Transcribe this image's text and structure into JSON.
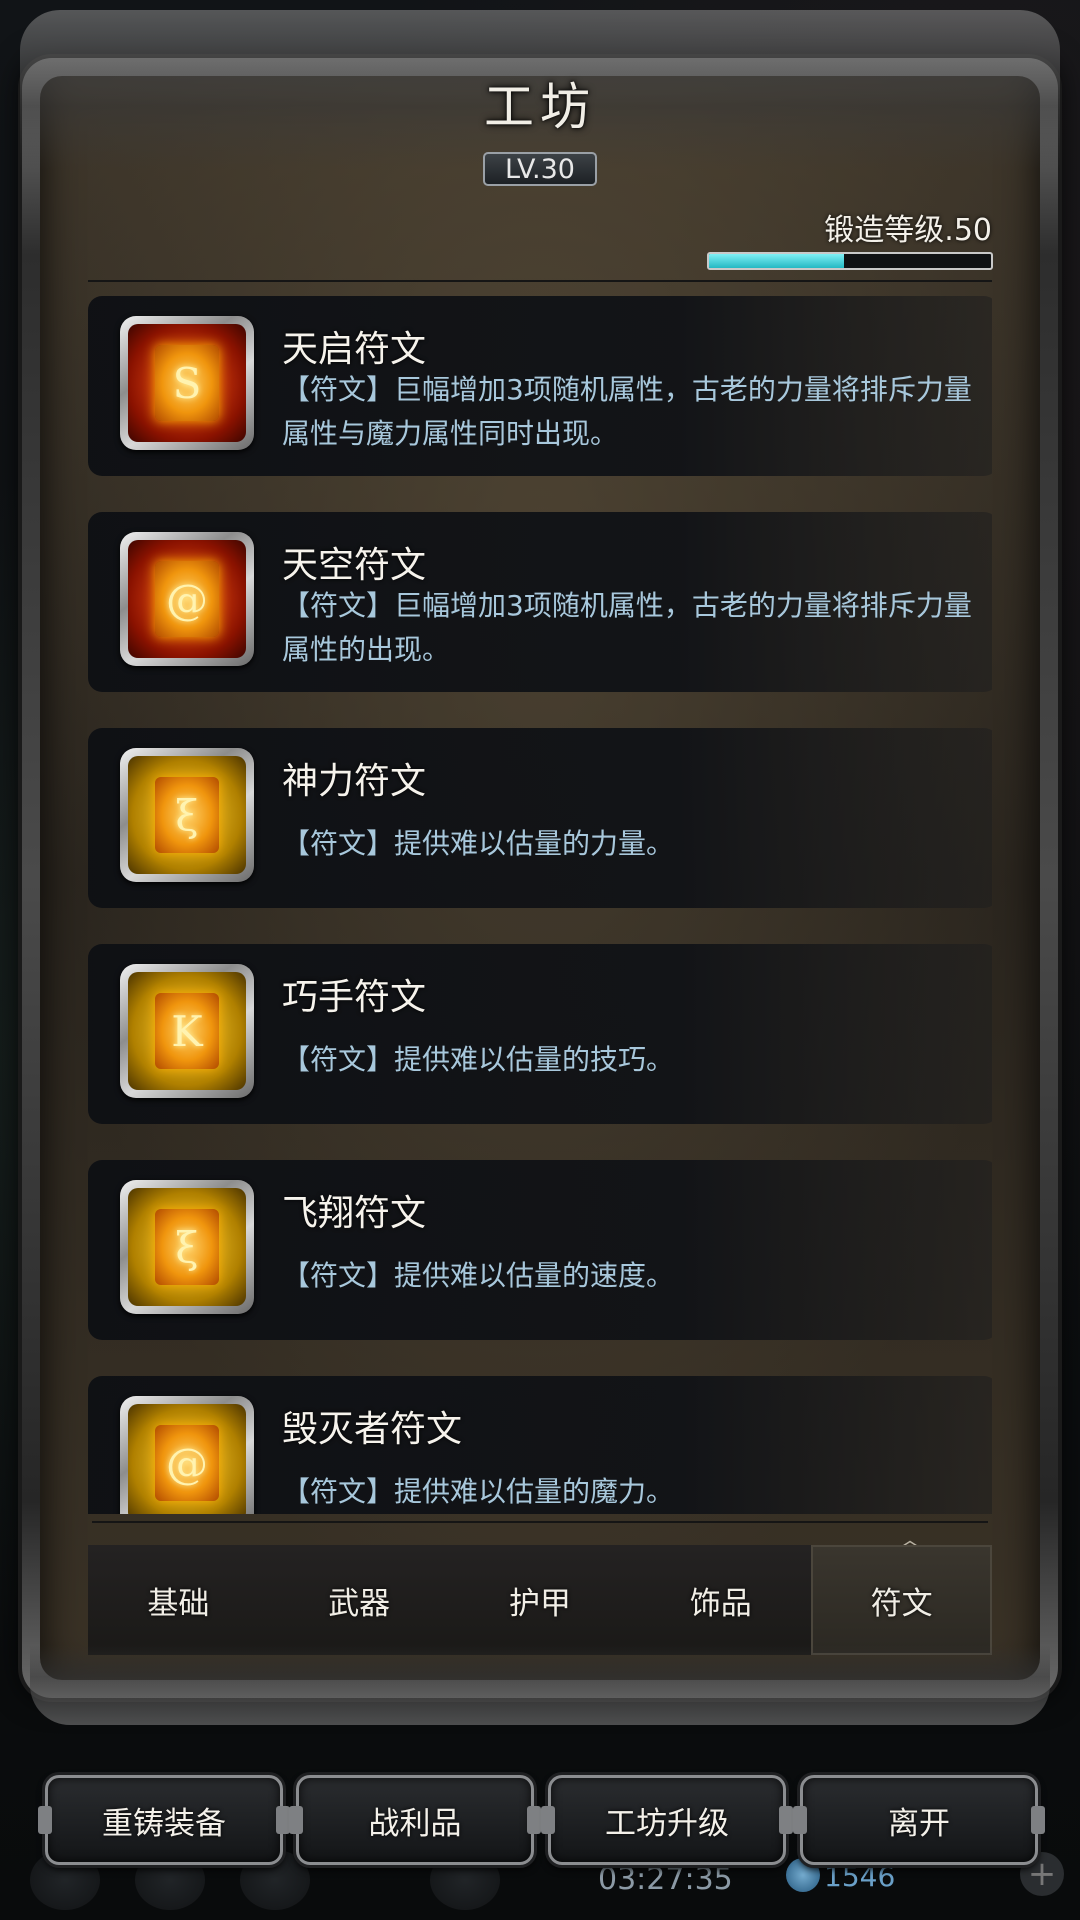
{
  "header": {
    "title": "工坊",
    "level": "LV.30"
  },
  "forge": {
    "label": "锻造等级.50",
    "progress": 0.48,
    "bar_color": "#2fc4cf"
  },
  "runes": [
    {
      "name": "天启符文",
      "desc": "【符文】巨幅增加3项随机属性，古老的力量将排斥力量属性与魔力属性同时出现。",
      "frame": "red",
      "glyph": "S",
      "icon": "rune-s-icon"
    },
    {
      "name": "天空符文",
      "desc": "【符文】巨幅增加3项随机属性，古老的力量将排斥力量属性的出现。",
      "frame": "red",
      "glyph": "@",
      "icon": "rune-swirl-icon"
    },
    {
      "name": "神力符文",
      "desc": "【符文】提供难以估量的力量。",
      "frame": "gold",
      "glyph": "ξ",
      "icon": "rune-power-icon"
    },
    {
      "name": "巧手符文",
      "desc": "【符文】提供难以估量的技巧。",
      "frame": "gold",
      "glyph": "K",
      "icon": "rune-k-icon"
    },
    {
      "name": "飞翔符文",
      "desc": "【符文】提供难以估量的速度。",
      "frame": "gold",
      "glyph": "ξ",
      "icon": "rune-wing-icon"
    },
    {
      "name": "毁灭者符文",
      "desc": "【符文】提供难以估量的魔力。",
      "frame": "gold",
      "glyph": "@",
      "icon": "rune-swirl-icon"
    }
  ],
  "tabs": [
    {
      "label": "基础",
      "active": false
    },
    {
      "label": "武器",
      "active": false
    },
    {
      "label": "护甲",
      "active": false
    },
    {
      "label": "饰品",
      "active": false
    },
    {
      "label": "符文",
      "active": true
    }
  ],
  "actions": {
    "reforge": "重铸装备",
    "loot": "战利品",
    "upgrade": "工坊升级",
    "leave": "离开"
  },
  "hud": {
    "time": "03:27:35",
    "gems": "1546"
  }
}
